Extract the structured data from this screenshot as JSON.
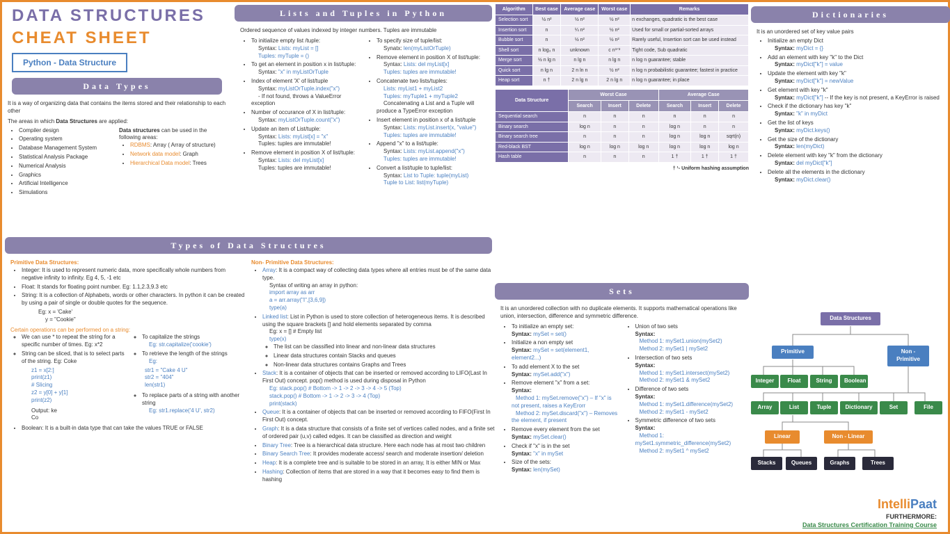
{
  "title1": "DATA STRUCTURES",
  "title2": "CHEAT SHEET",
  "subtitle": "Python - Data Structure",
  "dataTypes": {
    "h": "Data Types",
    "intro": "It is a way of organizing data that contains the items stored and their relationship to each other",
    "intro2a": "The areas in which ",
    "intro2b": "Data Structures",
    "intro2c": " are applied:",
    "areas": [
      "Compiler design",
      "Operating system",
      "Database Management System",
      "Statistical Analysis Package",
      "Numerical Analysis",
      "Graphics",
      "Artificial Intelligence",
      "Simulations"
    ],
    "useIntro": " can be used in the following areas:",
    "usePrefix": "Data structures",
    "uses": [
      {
        "a": "RDBMS",
        "b": ": Array ( Array of structure)"
      },
      {
        "a": "Network data model",
        "b": ": Graph"
      },
      {
        "a": "Hierarchical Data model",
        "b": ": Trees"
      }
    ]
  },
  "lists": {
    "h": "Lists and Tuples in Python",
    "intro": "Ordered sequence of values indexed by integer numbers. Tuples are immutable",
    "left": [
      {
        "t": "To initialize empty list /tuple:",
        "s": [
          "Syntax: ",
          "Lists: myList = []",
          " ",
          "Tuples: myTuple = ()"
        ]
      },
      {
        "t": "To get an element in position x in list/tuple:",
        "s": [
          "Syntax: ",
          "\"x\" in myListOrTuple"
        ]
      },
      {
        "t": "Index of element 'X' of list/tuple",
        "s": [
          "Syntax: ",
          "myListOrTuple.index(\"x\")",
          " - If not found, throws a ValueError exception"
        ]
      },
      {
        "t": "Number of occurance of X in list/tuple:",
        "s": [
          "Syntax: ",
          "myListOrTuple.count(\"x\")"
        ]
      },
      {
        "t": "Update an item of List/tuple:",
        "s": [
          "Syntax: ",
          "Lists: myList[x] = \"x\"",
          " Tuples: tuples are immutable!"
        ]
      },
      {
        "t": "Remove element in position X of list/tuple:",
        "s": [
          "Syntax: ",
          "Lists: del myList[x]",
          " Tuples: tuples are immutable!"
        ]
      }
    ],
    "right": [
      {
        "t": "To specify size of tuple/list:",
        "s": [
          "Synatx: ",
          "len(myListOrTuple)"
        ]
      },
      {
        "t": "Remove element in position X of list/tuple:",
        "s": [
          "Syntax: ",
          "Lists: del myList[x]",
          " ",
          "Tuples: tuples are immutable!"
        ]
      },
      {
        "t": "Concatenate two lists/tuples:",
        "s": [
          "",
          "Lists: myList1 + myList2",
          " ",
          "Tuples: myTuple1 + myTuple2",
          " Concatenating a List and a Tuple will produce a TypeError exception"
        ]
      },
      {
        "t": "Insert element in position x of a list/tuple",
        "s": [
          "Syntax: ",
          "Lists: myList.insert(x, \"value\")",
          " ",
          "Tuples: tuples are immutable!"
        ]
      },
      {
        "t": "Append \"x\" to a list/tuple:",
        "s": [
          "Syntax: ",
          "Lists: myList.append(\"x\")",
          " ",
          "Tuples: tuples are immutable!"
        ]
      },
      {
        "t": "Convert a list/tuple to tuple/list:",
        "s": [
          "Syntax: ",
          "List to Tuple: tuple(myList)",
          " ",
          "Tuple to List: list(myTuple)"
        ]
      }
    ]
  },
  "typesDS": {
    "h": "Types of Data Structures",
    "primH": "Primitive Data Structures:",
    "prim": [
      "Integer: It is used to represent numeric data, more specifically whole numbers from negative infinity to infinity. Eg 4, 5, -1 etc",
      "Float: It stands for floating point number. Eg: 1.1,2.3,9.3 etc",
      "String: It is a collection of Alphabets, words or other characters. In python it can be created by using a pair of single or double quotes for the sequence."
    ],
    "eg1": "Eg: x = 'Cake'",
    "eg2": "y = \"Cookie\"",
    "opsH": "Certain operations can be performed on a string:",
    "opsL": [
      "We can use * to repeat the string for a specific number of times. Eg: x*2",
      "String can be sliced, that is to select parts of the string. Eg: Coke"
    ],
    "codeL": [
      "z1 = x[2:]",
      "print(z1)",
      "# Slicing",
      "z2 = y[0] + y[1]",
      "print(z2)"
    ],
    "outL": [
      "Output: ke",
      "Co"
    ],
    "opsR": [
      {
        "t": "To capitalize the strings",
        "c": "Eg: str.capitalize('cookie')"
      },
      {
        "t": "To retrieve the length of the strings",
        "c": "Eg:"
      }
    ],
    "codeR": [
      "str1 = \"Cake 4 U\"",
      "str2 = \"404\"",
      "len(str1)"
    ],
    "replaceT": "To replace parts of a string with another string",
    "replaceC": "Eg: str1.replace('4 U', str2)",
    "boolT": "Boolean: It is a built-in data type that can take the values TRUE or FALSE",
    "nonH": "Non- Primitive Data Structures:",
    "nonItems": [
      {
        "h": "Array",
        "t": ": It is a compact way of collecting data types where all entries must be of the same data type.",
        "sub": "Syntax of writing an array in python:",
        "code": [
          "import array as arr",
          "a = arr.array(\"I\",[3,6,9])",
          "type(a)"
        ]
      },
      {
        "h": "Linked list",
        "t": ": List in Python is used to store collection of heterogeneous items. It is described using the square brackets [] and hold elements separated by comma",
        "sub": "Eg: x = [] # Empty list",
        "code": [
          "type(x)"
        ],
        "bullets": [
          "The list can be classified into linear and non-linear data structures",
          "Linear data structures contain Stacks and queues",
          "Non-linear data structures contains Graphs and Trees"
        ]
      },
      {
        "h": "Stack",
        "t": ": It is a container of objects that can be inserted or removed according to LIFO(Last In First Out) concept. pop() method is used during disposal in Python",
        "code": [
          "Eg: stack.pop() # Bottom -> 1 -> 2 -> 3 -> 4 -> 5 (Top)",
          "stack.pop() # Bottom -> 1 -> 2 -> 3 -> 4 (Top)",
          "print(stack)"
        ]
      },
      {
        "h": "Queue",
        "t": ": It is a container of objects that can be inserted or removed according to FIFO(First In First Out) concept."
      },
      {
        "h": "Graph",
        "t": ": It is a data structure that consists of a finite set of vertices called nodes, and a finite set of ordered pair (u,v) called edges. It can be classified as direction and weight"
      },
      {
        "h": "Binary Tree",
        "t": ": Tree is a hierarchical data structure. Here each node has at most two children"
      },
      {
        "h": "Binary Search Tree",
        "t": ": It provides moderate access/ search and moderate insertion/ deletion"
      },
      {
        "h": "Heap",
        "t": ": It is a complete tree and is suitable to be stored in an array, It is either MIN or Max"
      },
      {
        "h": "Hashing",
        "t": ": Collection of items that are stored in a way that it becomes easy to find them is hashing"
      }
    ]
  },
  "algo": {
    "headers": [
      "Algorithm",
      "Best case",
      "Average case",
      "Worst case",
      "Remarks"
    ],
    "rows": [
      [
        "Selection sort",
        "½ n²",
        "½ n²",
        "½ n²",
        "n exchanges, quadratic is the best case"
      ],
      [
        "Insertion sort",
        "n",
        "¼ n²",
        "½ n²",
        "Used for small or partial-sorted arrays"
      ],
      [
        "Bubble sort",
        "n",
        "½ n²",
        "½ n²",
        "Rarely useful, Insertion sort can be used instead"
      ],
      [
        "Shell sort",
        "n log₃ n",
        "unknown",
        "c n³ᐟ²",
        "Tight code, Sub quadratic"
      ],
      [
        "Merge sort",
        "½ n lg n",
        "n lg n",
        "n lg n",
        "n log n guarantee; stable"
      ],
      [
        "Quick sort",
        "n lg n",
        "2 n ln n",
        "½ n²",
        "n log n probabilistic guarantee; fastest in practice"
      ],
      [
        "Heap sort",
        "n †",
        "2 n lg n",
        "2 n lg n",
        "n log n guarantee; in place"
      ]
    ]
  },
  "ds": {
    "h2a": "Worst Case",
    "h2b": "Average Case",
    "headers": [
      "Data Structure",
      "Search",
      "Insert",
      "Delete",
      "Search",
      "Insert",
      "Delete"
    ],
    "rows": [
      [
        "Sequential search",
        "n",
        "n",
        "n",
        "n",
        "n",
        "n"
      ],
      [
        "Binary search",
        "log n",
        "n",
        "n",
        "log n",
        "n",
        "n"
      ],
      [
        "Binary search tree",
        "n",
        "n",
        "n",
        "log n",
        "log n",
        "sqrt(n)"
      ],
      [
        "Red-black BST",
        "log n",
        "log n",
        "log n",
        "log n",
        "log n",
        "log n"
      ],
      [
        "Hash table",
        "n",
        "n",
        "n",
        "1 †",
        "1 †",
        "1 †"
      ]
    ],
    "foot": "† ¹- Uniform hashing assumption"
  },
  "sets": {
    "h": "Sets",
    "intro": "It is an unordered collection with no duplicate elements. It supports mathematical operations like union, intersection, difference and symmetric difference.",
    "left": [
      {
        "t": "To initialize an empty set:",
        "s": "Syntax: ",
        "c": "mySet = set()"
      },
      {
        "t": "Initialize a non empty set",
        "s": "Syntax: ",
        "c": "mySet = set(element1, element2...)"
      },
      {
        "t": "To add element X to the set",
        "s": "Syntax: ",
        "c": "mySet.add(\"x\")"
      },
      {
        "t": "Remove element \"x\" from a set:",
        "s": "Syntax:",
        "m1": "Method 1: mySet.remove(\"x\") – If \"x\" is not present, raises a KeyErorr",
        "m2": "Method 2: mySet.discard(\"x\") – Removes the element, if present"
      },
      {
        "t": "Remove every element from the set",
        "s": "Syntax: ",
        "c": "mySet.clear()"
      },
      {
        "t": "Check if \"x\" is in the set",
        "s": "Syntax: ",
        "c": "\"x\" in mySet"
      },
      {
        "t": "Size of the sets:",
        "s": "Syntax: ",
        "c": "len(mySet)"
      }
    ],
    "right": [
      {
        "t": "Union of two sets",
        "s": "Syntax:",
        "m1": "Method 1: mySet1.union(mySet2)",
        "m2": "Method 2: mySet1 | mySet2"
      },
      {
        "t": "Intersection of two sets",
        "s": "Syntax:",
        "m1": "Method 1: mySet1.intersect(mySet2)",
        "m2": "Method 2: mySet1 & mySet2"
      },
      {
        "t": "Difference of two sets",
        "s": "Syntax:",
        "m1": "Method 1: mySet1.difference(mySet2)",
        "m2": "Method 2: mySet1 - mySet2"
      },
      {
        "t": "Symmetric difference of two sets",
        "s": "Syntax:",
        "m1": "Method 1: mySet1.symmetric_difference(mySet2)",
        "m2": "Method 2: mySet1 ^ mySet2"
      }
    ]
  },
  "dict": {
    "h": "Dictionaries",
    "intro": "It is an unordered set of key value pairs",
    "items": [
      {
        "t": "Initialize an empty Dict",
        "s": "Syntax: ",
        "c": "myDict = {}"
      },
      {
        "t": "Add an element with key \"k\" to the Dict",
        "s": "Syntax: ",
        "c": "myDict[\"k\"] = value"
      },
      {
        "t": "Update the element with key \"k\"",
        "s": "Syntax: ",
        "c": "myDict[\"k\"] = newValue"
      },
      {
        "t": "Get element with key \"k\"",
        "s": "Syntax: ",
        "c": "myDict[\"k\"]",
        "extra": " -- If the key is not present, a KeyError is raised"
      },
      {
        "t": "Check if the dictionary has key \"k\"",
        "s": "Syntax: ",
        "c": "\"k\" in myDict"
      },
      {
        "t": "Get the list of keys",
        "s": "Syntax: ",
        "c": "myDict.keys()"
      },
      {
        "t": "Get the size of the dictionary",
        "s": "Syntax: ",
        "c": "len(myDict)"
      },
      {
        "t": "Delete element with key \"k\" from the dictionary",
        "s": "Syntax: ",
        "c": "del myDict[\"k\"]"
      },
      {
        "t": "Delete all the elements in the dictionary",
        "s": "Syntax: ",
        "c": "myDict.clear()"
      }
    ]
  },
  "tree": {
    "root": "Data Structures",
    "l1": [
      "Primitive",
      "Non - Primitive"
    ],
    "l2": [
      "Integer",
      "Float",
      "String",
      "Boolean"
    ],
    "l3": [
      "Array",
      "List",
      "Tuple",
      "Dictionary",
      "Set",
      "File"
    ],
    "l4": [
      "Linear",
      "Non - Linear"
    ],
    "l5": [
      "Stacks",
      "Queues",
      "Graphs",
      "Trees"
    ]
  },
  "logo": {
    "i": "Intelli",
    "p": "Paat"
  },
  "furthermore": "FURTHERMORE:",
  "course": "Data Structures Certification Training Course"
}
